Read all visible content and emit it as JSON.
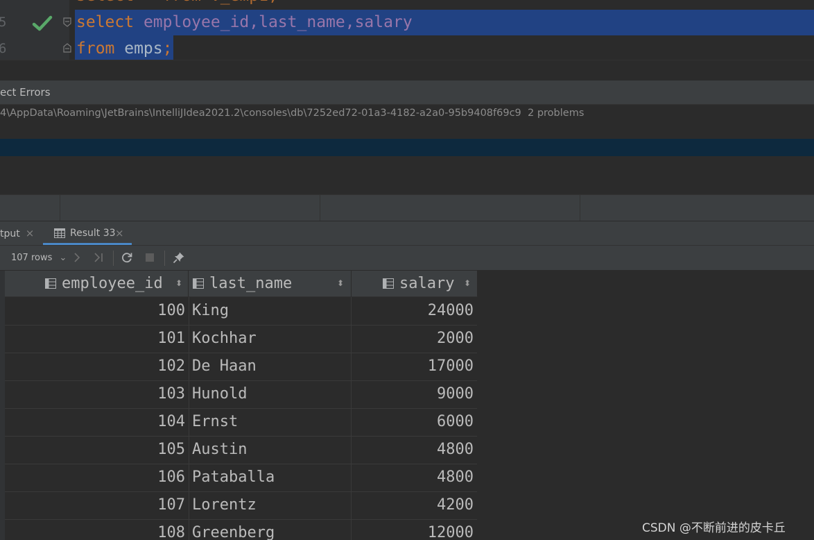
{
  "editor": {
    "lines": [
      {
        "num": "5",
        "keyword": "select",
        "rest": " employee_id,last_name,salary",
        "status": "ok"
      },
      {
        "num": "6",
        "keyword": "from",
        "rest": " emps",
        "terminator": ";"
      }
    ]
  },
  "errors_panel": {
    "title": "ect Errors",
    "path": "4\\AppData\\Roaming\\JetBrains\\IntelliJIdea2021.2\\consoles\\db\\7252ed72-01a3-4182-a2a0-95b9408f69c9",
    "problems": "2 problems"
  },
  "tabs": [
    {
      "label": "tput",
      "close": "×"
    },
    {
      "label": "Result 33",
      "close": "×",
      "icon": "table-grid-icon",
      "active": true
    }
  ],
  "toolbar": {
    "rows_label": "107 rows",
    "rows_chevron": "⌄",
    "icons": [
      "next-page-icon",
      "last-page-icon",
      "refresh-icon",
      "stop-icon",
      "pin-icon"
    ]
  },
  "result_table": {
    "columns": [
      {
        "label": "employee_id",
        "sort": "⬍"
      },
      {
        "label": "last_name",
        "sort": "⬍"
      },
      {
        "label": "salary",
        "sort": "⬍"
      }
    ],
    "rows": [
      [
        "100",
        "King",
        "24000"
      ],
      [
        "101",
        "Kochhar",
        "2000"
      ],
      [
        "102",
        "De Haan",
        "17000"
      ],
      [
        "103",
        "Hunold",
        "9000"
      ],
      [
        "104",
        "Ernst",
        "6000"
      ],
      [
        "105",
        "Austin",
        "4800"
      ],
      [
        "106",
        "Pataballa",
        "4800"
      ],
      [
        "107",
        "Lorentz",
        "4200"
      ],
      [
        "108",
        "Greenberg",
        "12000"
      ]
    ]
  },
  "watermark": "CSDN @不断前进的皮卡丘",
  "colors": {
    "background": "#2b2b2b",
    "keyword": "#cc7832",
    "identifier": "#9876aa",
    "selection": "#214283",
    "check": "#59a869",
    "tab_active": "#4a88c7"
  }
}
